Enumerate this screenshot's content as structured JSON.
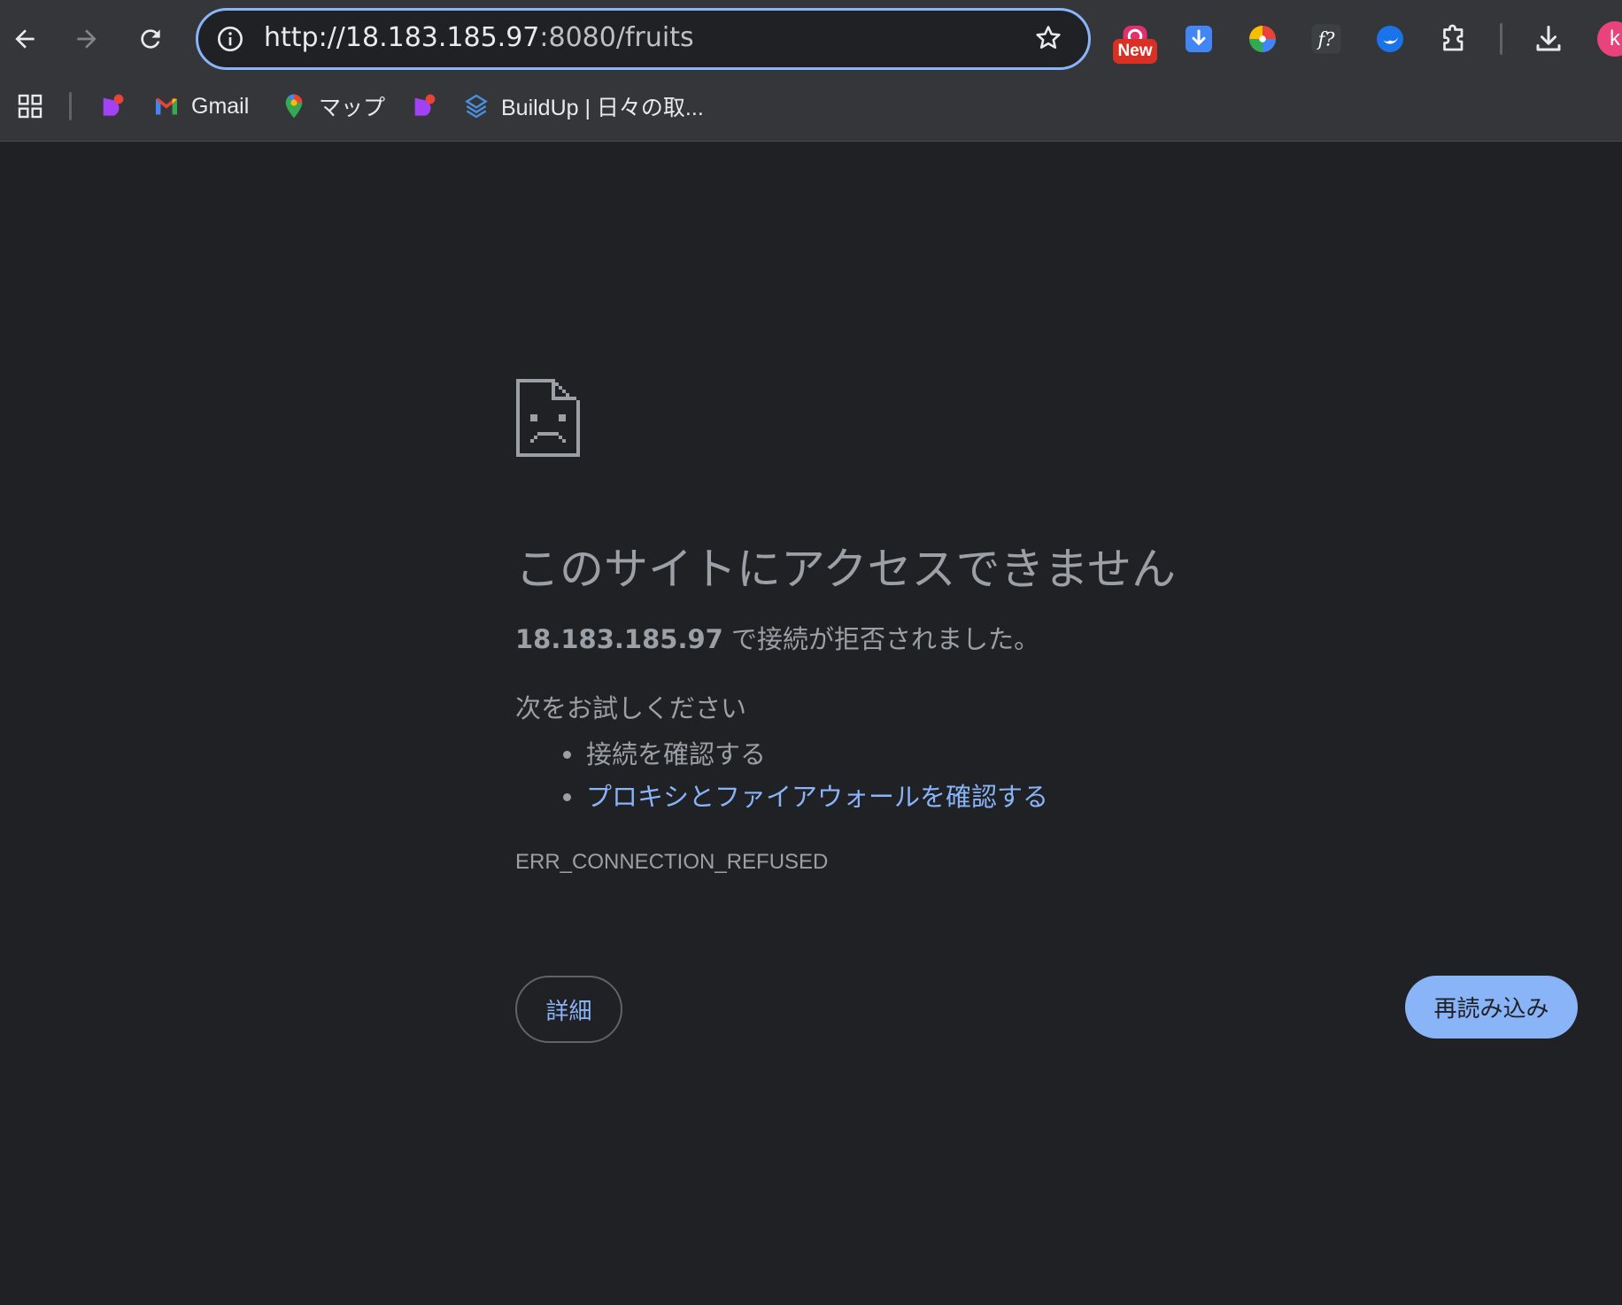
{
  "toolbar": {
    "url_host": "http://18.183.185.97",
    "url_path": ":8080/fruits",
    "new_badge": "New",
    "avatar_letter": "k"
  },
  "bookmarks": [
    {
      "icon": "b-logo-icon",
      "label": ""
    },
    {
      "icon": "gmail-icon",
      "label": "Gmail"
    },
    {
      "icon": "maps-icon",
      "label": "マップ"
    },
    {
      "icon": "b-logo-icon",
      "label": ""
    },
    {
      "icon": "buildup-icon",
      "label": "BuildUp | 日々の取..."
    }
  ],
  "error": {
    "title": "このサイトにアクセスできません",
    "host": "18.183.185.97",
    "desc_rest": " で接続が拒否されました。",
    "suggest_heading": "次をお試しください",
    "suggestions": [
      {
        "text": "接続を確認する",
        "link": false
      },
      {
        "text": "プロキシとファイアウォールを確認する",
        "link": true
      }
    ],
    "code": "ERR_CONNECTION_REFUSED",
    "details_label": "詳細",
    "reload_label": "再読み込み"
  },
  "colors": {
    "background": "#202124",
    "toolbar": "#35363a",
    "accent": "#8ab4f8",
    "text": "#9aa0a6",
    "badge": "#d93025",
    "avatar": "#e8437a"
  }
}
